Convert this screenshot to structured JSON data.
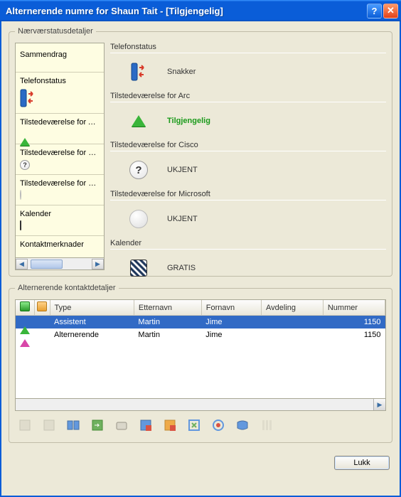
{
  "window": {
    "title": "Alternerende numre for Shaun Tait - [Tilgjengelig]"
  },
  "presence": {
    "group_label": "Nærværstatusdetaljer",
    "sidebar": {
      "items": [
        {
          "label": "Sammendrag"
        },
        {
          "label": "Telefonstatus"
        },
        {
          "label": "Tilstedeværelse for Arc"
        },
        {
          "label": "Tilstedeværelse for Cisco"
        },
        {
          "label": "Tilstedeværelse for Microsoft"
        },
        {
          "label": "Kalender"
        },
        {
          "label": "Kontaktmerknader"
        }
      ]
    },
    "sections": {
      "phone": {
        "title": "Telefonstatus",
        "value": "Snakker"
      },
      "arc": {
        "title": "Tilstedeværelse for Arc",
        "value": "Tilgjengelig"
      },
      "cisco": {
        "title": "Tilstedeværelse for Cisco",
        "value": "UKJENT"
      },
      "ms": {
        "title": "Tilstedeværelse for Microsoft",
        "value": "UKJENT"
      },
      "cal": {
        "title": "Kalender",
        "value": "GRATIS"
      }
    }
  },
  "alternates": {
    "group_label": "Alternerende kontaktdetaljer",
    "columns": {
      "type": "Type",
      "lastname": "Etternavn",
      "firstname": "Fornavn",
      "dept": "Avdeling",
      "number": "Nummer"
    },
    "rows": [
      {
        "type": "Assistent",
        "lastname": "Martin",
        "firstname": "Jime",
        "dept": "",
        "number": "1150",
        "icon": "green"
      },
      {
        "type": "Alternerende",
        "lastname": "Martin",
        "firstname": "Jime",
        "dept": "",
        "number": "1150",
        "icon": "pink"
      }
    ]
  },
  "footer": {
    "close": "Lukk"
  }
}
